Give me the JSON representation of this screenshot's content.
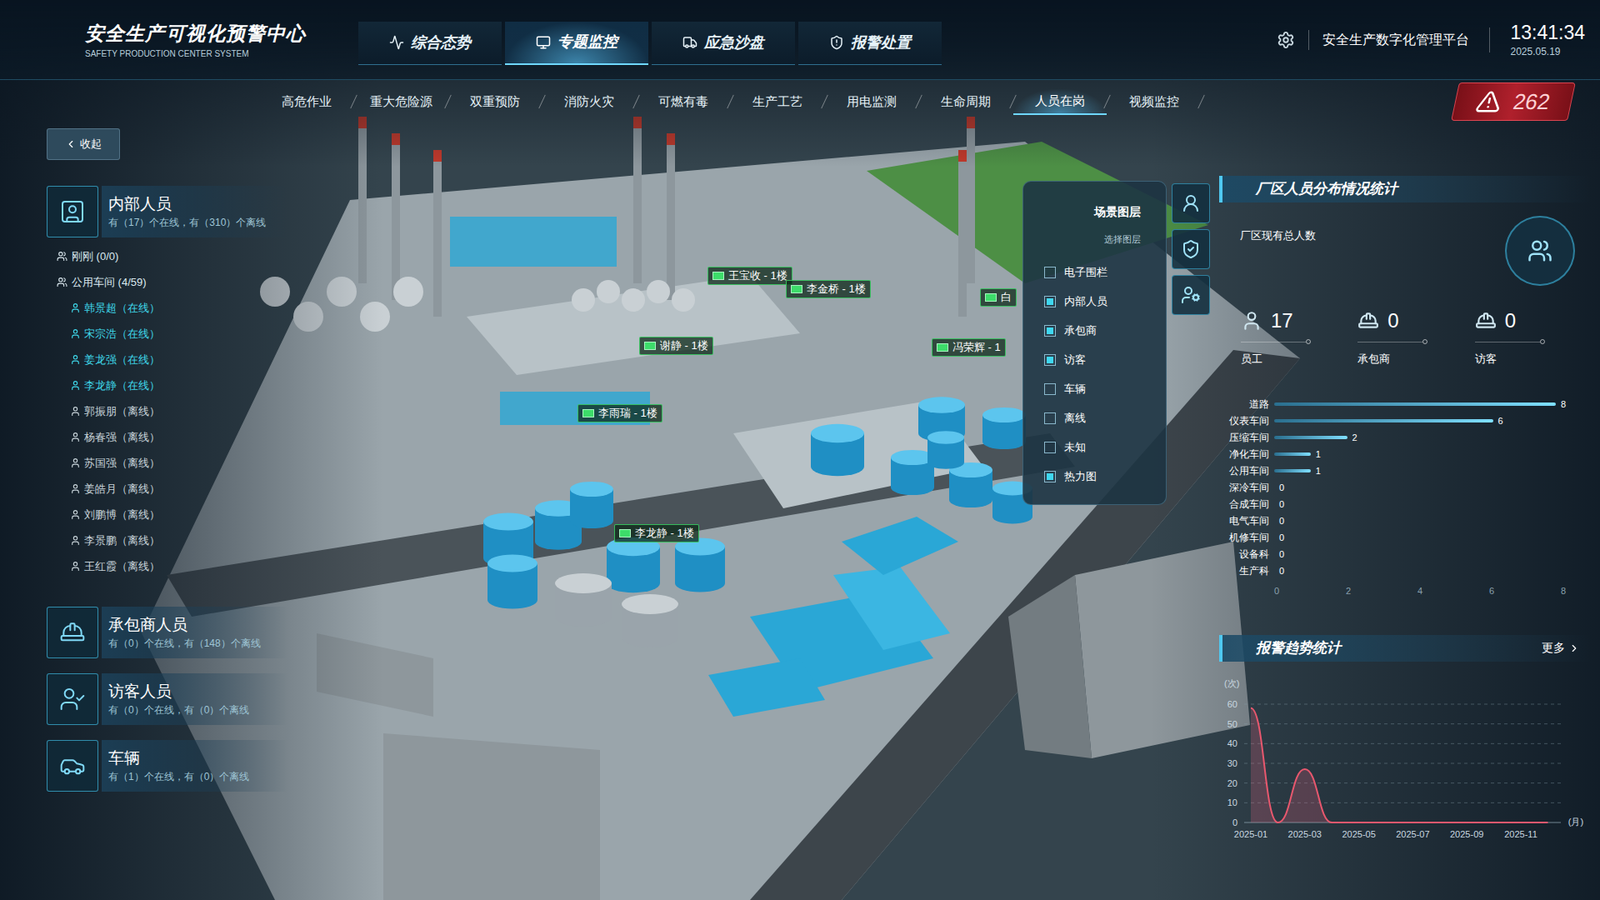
{
  "header": {
    "title": "安全生产可视化预警中心",
    "subtitle": "SAFETY PRODUCTION CENTER SYSTEM",
    "platform": "安全生产数字化管理平台",
    "time": "13:41:34",
    "date": "2025.05.19"
  },
  "nav_tabs": [
    {
      "label": "综合态势",
      "selected": false
    },
    {
      "label": "专题监控",
      "selected": true
    },
    {
      "label": "应急沙盘",
      "selected": false
    },
    {
      "label": "报警处置",
      "selected": false
    }
  ],
  "sub_tabs": [
    {
      "label": "高危作业",
      "selected": false
    },
    {
      "label": "重大危险源",
      "selected": false
    },
    {
      "label": "双重预防",
      "selected": false
    },
    {
      "label": "消防火灾",
      "selected": false
    },
    {
      "label": "可燃有毒",
      "selected": false
    },
    {
      "label": "生产工艺",
      "selected": false
    },
    {
      "label": "用电监测",
      "selected": false
    },
    {
      "label": "生命周期",
      "selected": false
    },
    {
      "label": "人员在岗",
      "selected": true
    },
    {
      "label": "视频监控",
      "selected": false
    }
  ],
  "alarm": {
    "count": "262"
  },
  "collapse_button": {
    "label": "收起"
  },
  "left_panel": {
    "internal": {
      "title": "内部人员",
      "summary": "有（17）个在线，有（310）个离线",
      "groups": [
        {
          "label": "刚刚 (0/0)"
        },
        {
          "label": "公用车间 (4/59)"
        }
      ],
      "people": [
        {
          "name": "韩景超（在线）",
          "online": true
        },
        {
          "name": "宋宗浩（在线）",
          "online": true
        },
        {
          "name": "姜龙强（在线）",
          "online": true
        },
        {
          "name": "李龙静（在线）",
          "online": true
        },
        {
          "name": "郭振朋（离线）",
          "online": false
        },
        {
          "name": "杨春强（离线）",
          "online": false
        },
        {
          "name": "苏国强（离线）",
          "online": false
        },
        {
          "name": "姜皓月（离线）",
          "online": false
        },
        {
          "name": "刘鹏博（离线）",
          "online": false
        },
        {
          "name": "李景鹏（离线）",
          "online": false
        },
        {
          "name": "王红霞（离线）",
          "online": false
        }
      ]
    },
    "categories": [
      {
        "title": "承包商人员",
        "summary": "有（0）个在线，有（148）个离线"
      },
      {
        "title": "访客人员",
        "summary": "有（0）个在线，有（0）个离线"
      },
      {
        "title": "车辆",
        "summary": "有（1）个在线，有（0）个离线"
      }
    ]
  },
  "map_pins": [
    {
      "label": "王宝收 - 1楼"
    },
    {
      "label": "李金桥 - 1楼"
    },
    {
      "label": "谢静 - 1楼"
    },
    {
      "label": "冯荣辉 - 1"
    },
    {
      "label": "白"
    },
    {
      "label": "李雨瑞 - 1楼"
    },
    {
      "label": "李龙静 - 1楼"
    }
  ],
  "layer_panel": {
    "title": "场景图层",
    "subtitle": "选择图层",
    "layers": [
      {
        "label": "电子围栏",
        "checked": false
      },
      {
        "label": "内部人员",
        "checked": true
      },
      {
        "label": "承包商",
        "checked": true
      },
      {
        "label": "访客",
        "checked": true
      },
      {
        "label": "车辆",
        "checked": false
      },
      {
        "label": "离线",
        "checked": false
      },
      {
        "label": "未知",
        "checked": false
      },
      {
        "label": "热力图",
        "checked": true
      }
    ]
  },
  "staff_stats": {
    "title": "厂区人员分布情况统计",
    "total_label": "厂区现有总人数",
    "items": [
      {
        "value": "17",
        "label": "员工"
      },
      {
        "value": "0",
        "label": "承包商"
      },
      {
        "value": "0",
        "label": "访客"
      }
    ]
  },
  "distribution_chart": {
    "axis_ticks": [
      "0",
      "2",
      "4",
      "6",
      "8"
    ],
    "rows": [
      {
        "label": "道路",
        "value": 8,
        "reading": "8"
      },
      {
        "label": "仪表车间",
        "value": 6,
        "reading": "6"
      },
      {
        "label": "压缩车间",
        "value": 2,
        "reading": "2"
      },
      {
        "label": "净化车间",
        "value": 1,
        "reading": "1"
      },
      {
        "label": "公用车间",
        "value": 1,
        "reading": "1"
      },
      {
        "label": "深冷车间",
        "value": 0,
        "reading": "0"
      },
      {
        "label": "合成车间",
        "value": 0,
        "reading": "0"
      },
      {
        "label": "电气车间",
        "value": 0,
        "reading": "0"
      },
      {
        "label": "机修车间",
        "value": 0,
        "reading": "0"
      },
      {
        "label": "设备科",
        "value": 0,
        "reading": "0"
      },
      {
        "label": "生产科",
        "value": 0,
        "reading": "0"
      }
    ]
  },
  "alarm_trend": {
    "title": "报警趋势统计",
    "more": "更多",
    "y_unit": "(次)",
    "x_unit": "(月)",
    "y_ticks": [
      "60",
      "50",
      "40",
      "30",
      "20",
      "10",
      "0"
    ],
    "x_ticks": [
      "2025-01",
      "2025-03",
      "2025-05",
      "2025-07",
      "2025-09",
      "2025-11"
    ],
    "series": [
      {
        "values": [
          58,
          0,
          27,
          0,
          0,
          0,
          0,
          0,
          0,
          0,
          0,
          0
        ]
      }
    ]
  }
}
